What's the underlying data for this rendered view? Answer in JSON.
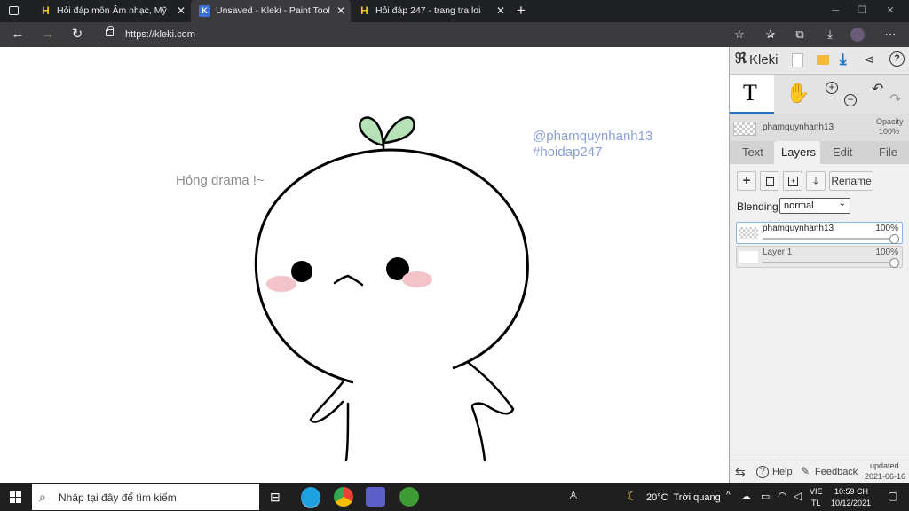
{
  "tabs": [
    {
      "title": "Hỏi đáp môn Âm nhạc, Mỹ thuật",
      "icon": "H"
    },
    {
      "title": "Unsaved - Kleki - Paint Tool",
      "icon": "K"
    },
    {
      "title": "Hỏi đáp 247 - trang tra loi",
      "icon": "H"
    }
  ],
  "address": {
    "url": "https://kleki.com"
  },
  "canvas": {
    "left_text": "Hóng drama !~",
    "watermark_line1": "@phamquynhanh13",
    "watermark_line2": "#hoidap247"
  },
  "panel": {
    "logo": "Kleki",
    "layer_name": "phamquynhanh13",
    "opacity_label": "Opacity",
    "opacity_value": "100%",
    "tabs": [
      "Text",
      "Layers",
      "Edit",
      "File"
    ],
    "active_tab": "Layers",
    "rename_label": "Rename",
    "blending_label": "Blending",
    "blending_value": "normal",
    "layers": [
      {
        "name": "phamquynhanh13",
        "opacity": "100%"
      },
      {
        "name": "Layer 1",
        "opacity": "100%"
      }
    ],
    "help_label": "Help",
    "feedback_label": "Feedback",
    "updated_label": "updated",
    "updated_date": "2021-06-16"
  },
  "taskbar": {
    "search_placeholder": "Nhập tại đây để tìm kiếm",
    "weather": "20°C  Trời quang",
    "lang1": "VIE",
    "lang2": "TL",
    "time": "10:59 CH",
    "date": "10/12/2021"
  },
  "colors": {
    "accent": "#1e73c9",
    "chrome": "#202124",
    "panel": "#dedede"
  }
}
